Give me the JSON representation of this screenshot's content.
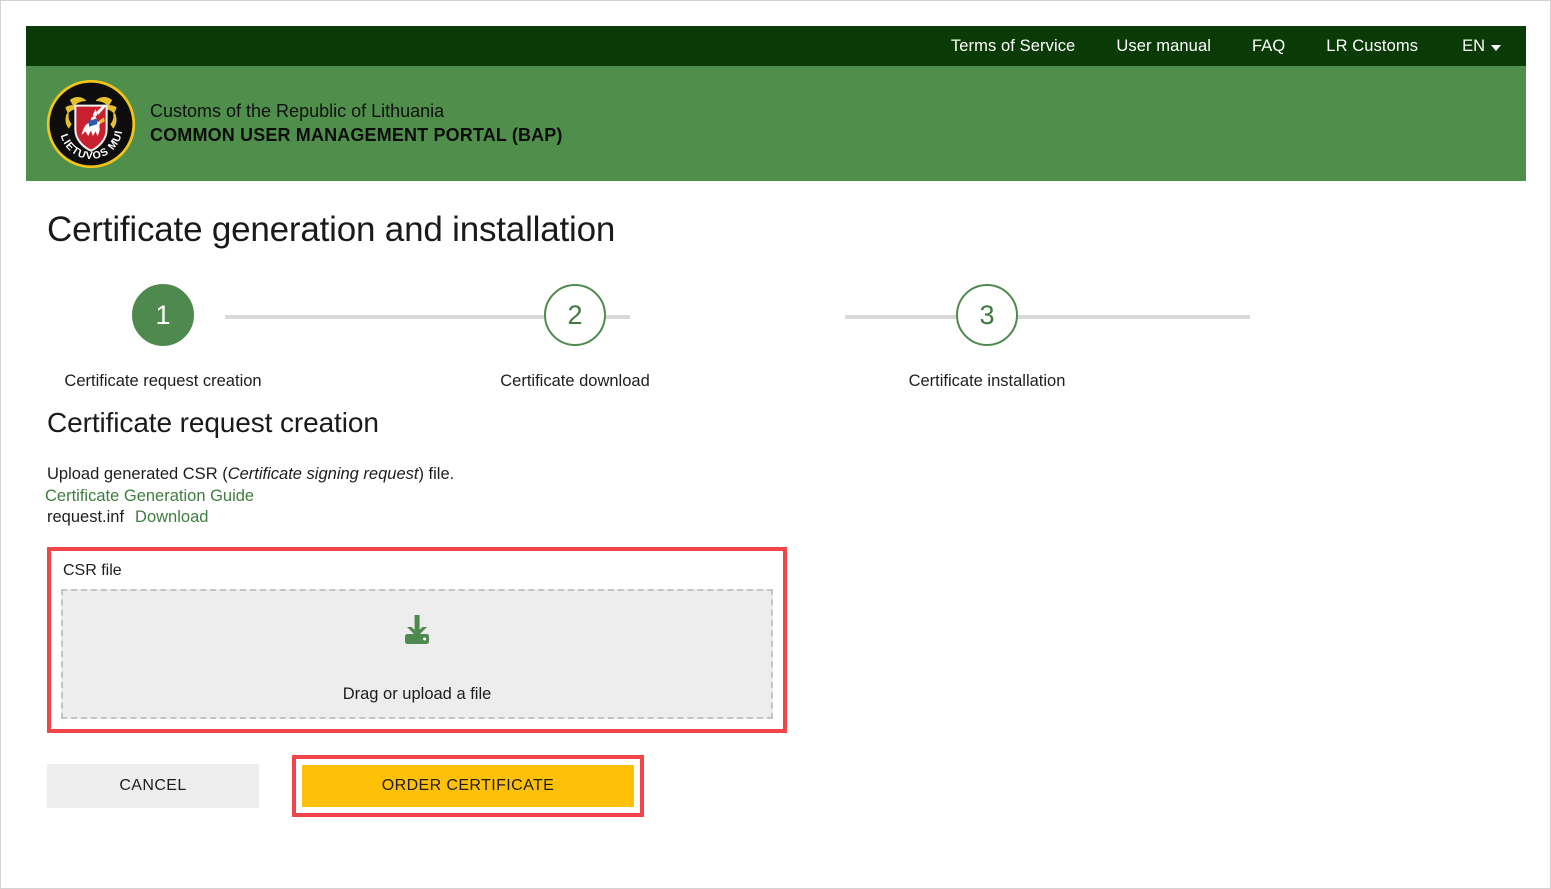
{
  "topbar": {
    "links": [
      {
        "label": "Terms of Service",
        "name": "terms-of-service-link"
      },
      {
        "label": "User manual",
        "name": "user-manual-link"
      },
      {
        "label": "FAQ",
        "name": "faq-link"
      },
      {
        "label": "LR Customs",
        "name": "lr-customs-link"
      }
    ],
    "language": "EN",
    "language_icon": "chevron-down-icon",
    "background": "#0a3a05"
  },
  "header": {
    "logo_icon": "lithuania-customs-emblem",
    "logo_ring_text": "LIETUVOS MUITINĖ",
    "organisation": "Customs of the Republic of Lithuania",
    "portal": "COMMON USER MANAGEMENT PORTAL (BAP)",
    "background": "#4f8f4b"
  },
  "page": {
    "title": "Certificate generation and installation"
  },
  "stepper": {
    "steps": [
      {
        "number": "1",
        "label": "Certificate request creation",
        "active": true
      },
      {
        "number": "2",
        "label": "Certificate download",
        "active": false
      },
      {
        "number": "3",
        "label": "Certificate installation",
        "active": false
      }
    ],
    "active_color": "#4e8a4e",
    "line_color": "#d9d9d9"
  },
  "section": {
    "title": "Certificate request creation",
    "intro_prefix": "Upload generated CSR (",
    "intro_emphasis": "Certificate signing request",
    "intro_suffix": ") file.",
    "guide_link": "Certificate Generation Guide",
    "file_name": "request.inf",
    "download_link": "Download",
    "link_color": "#3f7d3f"
  },
  "upload": {
    "label": "CSR file",
    "icon": "download-to-tray-icon",
    "drop_text": "Drag or upload a file",
    "icon_color": "#4e8a4e",
    "highlight_color": "#f2454b"
  },
  "actions": {
    "cancel_label": "CANCEL",
    "order_label": "ORDER CERTIFICATE",
    "order_color": "#ffc107",
    "highlight_color": "#f2454b"
  }
}
